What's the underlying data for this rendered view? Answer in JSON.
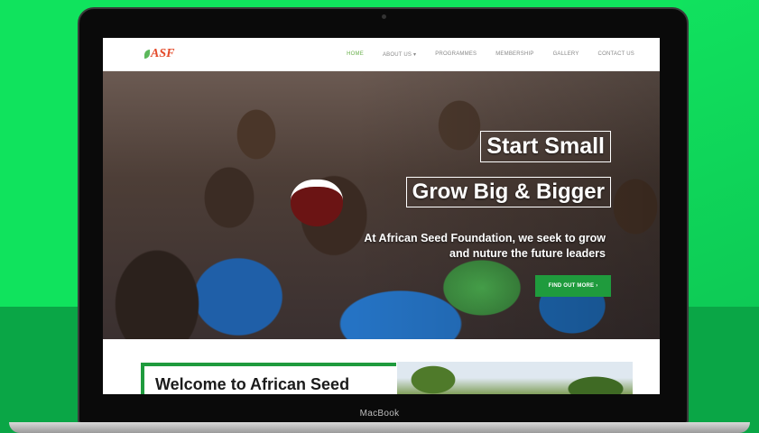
{
  "device": {
    "brand": "MacBook"
  },
  "site": {
    "logo_text": "ASF",
    "nav": [
      {
        "label": "HOME",
        "active": true
      },
      {
        "label": "ABOUT US ▾",
        "active": false
      },
      {
        "label": "PROGRAMMES",
        "active": false
      },
      {
        "label": "MEMBERSHIP",
        "active": false
      },
      {
        "label": "GALLERY",
        "active": false
      },
      {
        "label": "CONTACT US",
        "active": false
      }
    ],
    "hero": {
      "tagline_1": "Start Small",
      "tagline_2": "Grow Big & Bigger",
      "subtitle": "At African Seed Foundation, we seek to grow and nuture the future leaders",
      "cta_label": "FIND OUT MORE",
      "cta_icon": "chevron-right-icon"
    },
    "welcome": {
      "title": "Welcome to African Seed"
    }
  },
  "colors": {
    "background_green": "#10e35d",
    "accent_green": "#1f9b3d",
    "nav_active": "#6ab04c"
  }
}
